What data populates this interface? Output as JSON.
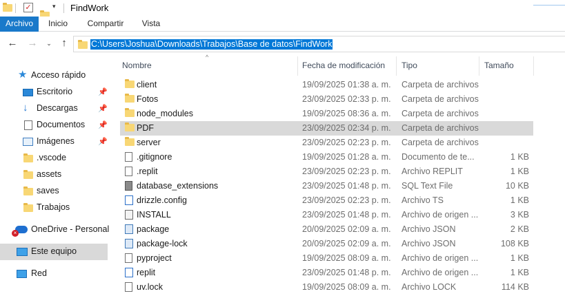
{
  "window": {
    "title": "FindWork"
  },
  "ribbon": {
    "tabs": [
      {
        "label": "Archivo"
      },
      {
        "label": "Inicio"
      },
      {
        "label": "Compartir"
      },
      {
        "label": "Vista"
      }
    ]
  },
  "address": {
    "path": "C:\\Users\\Joshua\\Downloads\\Trabajos\\Base de datos\\FindWork"
  },
  "sidebar": {
    "items": [
      {
        "label": "Acceso rápido",
        "icon": "star-icon"
      },
      {
        "label": "Escritorio",
        "icon": "desktop-icon",
        "pinned": true
      },
      {
        "label": "Descargas",
        "icon": "download-icon",
        "pinned": true
      },
      {
        "label": "Documentos",
        "icon": "documents-icon",
        "pinned": true
      },
      {
        "label": "Imágenes",
        "icon": "pictures-icon",
        "pinned": true
      },
      {
        "label": ".vscode",
        "icon": "folder-icon"
      },
      {
        "label": "assets",
        "icon": "folder-icon"
      },
      {
        "label": "saves",
        "icon": "folder-icon"
      },
      {
        "label": "Trabajos",
        "icon": "folder-icon"
      },
      {
        "label": "OneDrive - Personal",
        "icon": "onedrive-icon"
      },
      {
        "label": "Este equipo",
        "icon": "computer-icon",
        "selected": true
      },
      {
        "label": "Red",
        "icon": "network-icon"
      }
    ]
  },
  "columns": {
    "name": "Nombre",
    "date": "Fecha de modificación",
    "type": "Tipo",
    "size": "Tamaño"
  },
  "files": [
    {
      "name": "client",
      "date": "19/09/2025 01:38 a. m.",
      "type": "Carpeta de archivos",
      "size": "",
      "icon": "folder-icon"
    },
    {
      "name": "Fotos",
      "date": "23/09/2025 02:33 p. m.",
      "type": "Carpeta de archivos",
      "size": "",
      "icon": "folder-icon"
    },
    {
      "name": "node_modules",
      "date": "19/09/2025 08:36 a. m.",
      "type": "Carpeta de archivos",
      "size": "",
      "icon": "folder-icon"
    },
    {
      "name": "PDF",
      "date": "23/09/2025 02:34 p. m.",
      "type": "Carpeta de archivos",
      "size": "",
      "icon": "folder-icon",
      "selected": true
    },
    {
      "name": "server",
      "date": "23/09/2025 02:23 p. m.",
      "type": "Carpeta de archivos",
      "size": "",
      "icon": "folder-icon"
    },
    {
      "name": ".gitignore",
      "date": "19/09/2025 01:28 a. m.",
      "type": "Documento de te...",
      "size": "1 KB",
      "icon": "text-file-icon"
    },
    {
      "name": ".replit",
      "date": "23/09/2025 02:23 p. m.",
      "type": "Archivo REPLIT",
      "size": "1 KB",
      "icon": "file-icon"
    },
    {
      "name": "database_extensions",
      "date": "23/09/2025 01:48 p. m.",
      "type": "SQL Text File",
      "size": "10 KB",
      "icon": "database-file-icon"
    },
    {
      "name": "drizzle.config",
      "date": "23/09/2025 02:23 p. m.",
      "type": "Archivo TS",
      "size": "1 KB",
      "icon": "ts-file-icon"
    },
    {
      "name": "INSTALL",
      "date": "23/09/2025 01:48 p. m.",
      "type": "Archivo de origen ...",
      "size": "3 KB",
      "icon": "install-file-icon"
    },
    {
      "name": "package",
      "date": "20/09/2025 02:09 a. m.",
      "type": "Archivo JSON",
      "size": "2 KB",
      "icon": "json-file-icon"
    },
    {
      "name": "package-lock",
      "date": "20/09/2025 02:09 a. m.",
      "type": "Archivo JSON",
      "size": "108 KB",
      "icon": "json-file-icon"
    },
    {
      "name": "pyproject",
      "date": "19/09/2025 08:09 a. m.",
      "type": "Archivo de origen ...",
      "size": "1 KB",
      "icon": "file-icon"
    },
    {
      "name": "replit",
      "date": "23/09/2025 01:48 p. m.",
      "type": "Archivo de origen ...",
      "size": "1 KB",
      "icon": "ts-file-icon"
    },
    {
      "name": "uv.lock",
      "date": "19/09/2025 08:09 a. m.",
      "type": "Archivo LOCK",
      "size": "114 KB",
      "icon": "file-icon"
    }
  ]
}
